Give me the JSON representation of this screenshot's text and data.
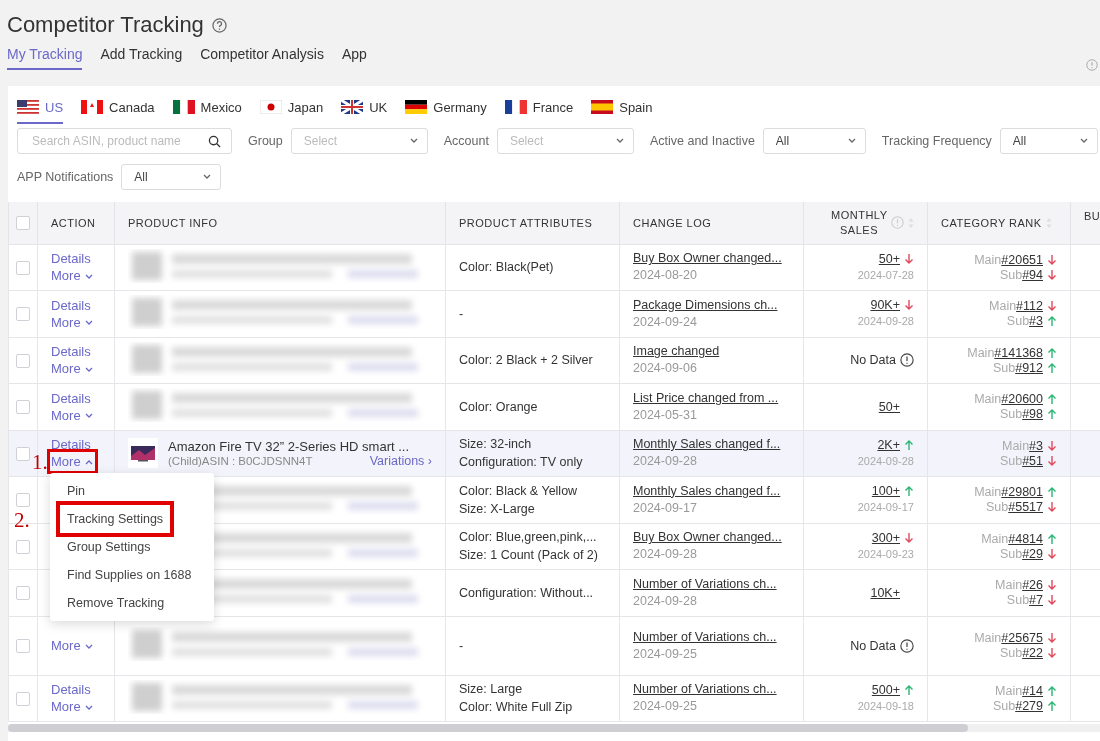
{
  "page": {
    "title": "Competitor Tracking"
  },
  "tabs": [
    {
      "label": "My Tracking",
      "selected": true
    },
    {
      "label": "Add Tracking",
      "selected": false
    },
    {
      "label": "Competitor Analysis",
      "selected": false
    },
    {
      "label": "App",
      "selected": false
    }
  ],
  "markets": [
    {
      "label": "US",
      "kind": "us",
      "selected": true
    },
    {
      "label": "Canada",
      "kind": "ca",
      "selected": false
    },
    {
      "label": "Mexico",
      "kind": "mx",
      "selected": false
    },
    {
      "label": "Japan",
      "kind": "jp",
      "selected": false
    },
    {
      "label": "UK",
      "kind": "uk",
      "selected": false
    },
    {
      "label": "Germany",
      "kind": "de",
      "selected": false
    },
    {
      "label": "France",
      "kind": "fr",
      "selected": false
    },
    {
      "label": "Spain",
      "kind": "es",
      "selected": false
    }
  ],
  "search": {
    "placeholder": "Search ASIN, product name"
  },
  "filters": [
    {
      "label": "Group",
      "placeholder": "Select"
    },
    {
      "label": "Account",
      "placeholder": "Select"
    },
    {
      "label": "Active and Inactive",
      "value": "All"
    },
    {
      "label": "Tracking Frequency",
      "value": "All"
    },
    {
      "label": "APP Notifications",
      "value": "All"
    }
  ],
  "table": {
    "select_all": {
      "checked": false
    },
    "columns": [
      "ACTION",
      "PRODUCT INFO",
      "PRODUCT ATTRIBUTES",
      "CHANGE LOG",
      "MONTHLY SALES",
      "CATEGORY RANK",
      "BU"
    ],
    "rows": [
      {
        "checked": false,
        "highlighted": false,
        "details": "Details",
        "more": "More",
        "expanded": false,
        "product": {
          "kind": "blurred"
        },
        "attributes": [
          "Color: Black(Pet)"
        ],
        "change": {
          "text": "Buy Box Owner changed...",
          "date": "2024-08-20"
        },
        "sales": {
          "kind": "value",
          "value": "50+",
          "rising": false,
          "date": "2024-07-28"
        },
        "rank": [
          {
            "label": "Main",
            "value": "#20651",
            "rising": false
          },
          {
            "label": "Sub",
            "value": "#94",
            "rising": false
          }
        ]
      },
      {
        "checked": false,
        "highlighted": false,
        "details": "Details",
        "more": "More",
        "expanded": false,
        "product": {
          "kind": "blurred"
        },
        "attributes": [
          "-"
        ],
        "change": {
          "text": "Package Dimensions ch...",
          "date": "2024-09-24"
        },
        "sales": {
          "kind": "value",
          "value": "90K+",
          "rising": false,
          "date": "2024-09-28"
        },
        "rank": [
          {
            "label": "Main",
            "value": "#112",
            "rising": false
          },
          {
            "label": "Sub",
            "value": "#3",
            "rising": true
          }
        ]
      },
      {
        "checked": false,
        "highlighted": false,
        "details": "Details",
        "more": "More",
        "expanded": false,
        "product": {
          "kind": "blurred"
        },
        "attributes": [
          "Color: 2 Black + 2 Silver"
        ],
        "change": {
          "text": "Image changed",
          "date": "2024-09-06"
        },
        "sales": {
          "kind": "no_data",
          "text": "No Data"
        },
        "rank": [
          {
            "label": "Main",
            "value": "#141368",
            "rising": true
          },
          {
            "label": "Sub",
            "value": "#912",
            "rising": true
          }
        ]
      },
      {
        "checked": false,
        "highlighted": false,
        "details": "Details",
        "more": "More",
        "expanded": false,
        "product": {
          "kind": "blurred"
        },
        "attributes": [
          "Color: Orange"
        ],
        "change": {
          "text": "List Price changed from ...",
          "date": "2024-05-31"
        },
        "sales": {
          "kind": "value",
          "value": "50+"
        },
        "rank": [
          {
            "label": "Main",
            "value": "#20600",
            "rising": true
          },
          {
            "label": "Sub",
            "value": "#98",
            "rising": true
          }
        ]
      },
      {
        "checked": false,
        "highlighted": true,
        "details": "Details",
        "more": "More",
        "expanded": true,
        "annotation": "1.",
        "product": {
          "kind": "product",
          "title": "Amazon Fire TV 32” 2-Series HD smart ...",
          "asin": "(Child)ASIN : B0CJDSNN4T",
          "variations": "Variations ›"
        },
        "attributes": [
          "Size: 32-inch",
          "Configuration: TV only"
        ],
        "change": {
          "text": "Monthly Sales changed f...",
          "date": "2024-09-28"
        },
        "sales": {
          "kind": "value",
          "value": "2K+",
          "rising": true,
          "date": "2024-09-28"
        },
        "rank": [
          {
            "label": "Main",
            "value": "#3",
            "rising": false
          },
          {
            "label": "Sub",
            "value": "#51",
            "rising": false
          }
        ]
      },
      {
        "checked": false,
        "highlighted": false,
        "product": {
          "kind": "blurred"
        },
        "attributes": [
          "Color: Black & Yellow",
          "Size: X-Large"
        ],
        "change": {
          "text": "Monthly Sales changed f...",
          "date": "2024-09-17"
        },
        "sales": {
          "kind": "value",
          "value": "100+",
          "rising": true,
          "date": "2024-09-17"
        },
        "rank": [
          {
            "label": "Main",
            "value": "#29801",
            "rising": true
          },
          {
            "label": "Sub",
            "value": "#5517",
            "rising": false
          }
        ]
      },
      {
        "checked": false,
        "highlighted": false,
        "product": {
          "kind": "blurred"
        },
        "attributes": [
          "Color: Blue,green,pink,...",
          "Size: 1 Count (Pack of 2)"
        ],
        "change": {
          "text": "Buy Box Owner changed...",
          "date": "2024-09-28"
        },
        "sales": {
          "kind": "value",
          "value": "300+",
          "rising": false,
          "date": "2024-09-23"
        },
        "rank": [
          {
            "label": "Main",
            "value": "#4814",
            "rising": true
          },
          {
            "label": "Sub",
            "value": "#29",
            "rising": false
          }
        ]
      },
      {
        "checked": false,
        "highlighted": false,
        "product": {
          "kind": "blurred"
        },
        "attributes": [
          "Configuration: Without..."
        ],
        "change": {
          "text": "Number of Variations ch...",
          "date": "2024-09-28"
        },
        "sales": {
          "kind": "value",
          "value": "10K+"
        },
        "rank": [
          {
            "label": "Main",
            "value": "#26",
            "rising": false
          },
          {
            "label": "Sub",
            "value": "#7",
            "rising": false
          }
        ]
      },
      {
        "checked": false,
        "highlighted": false,
        "more": "More",
        "expanded": false,
        "tall": true,
        "product": {
          "kind": "blurred"
        },
        "attributes": [
          "-"
        ],
        "change": {
          "text": "Number of Variations ch...",
          "date": "2024-09-25"
        },
        "sales": {
          "kind": "no_data",
          "text": "No Data"
        },
        "rank": [
          {
            "label": "Main",
            "value": "#25675",
            "rising": false
          },
          {
            "label": "Sub",
            "value": "#22",
            "rising": false
          }
        ]
      },
      {
        "checked": false,
        "highlighted": false,
        "details": "Details",
        "more": "More",
        "expanded": false,
        "product": {
          "kind": "blurred"
        },
        "attributes": [
          "Size: Large",
          "Color: White Full Zip"
        ],
        "change": {
          "text": "Number of Variations ch...",
          "date": "2024-09-25"
        },
        "sales": {
          "kind": "value",
          "value": "500+",
          "rising": true,
          "date": "2024-09-18"
        },
        "rank": [
          {
            "label": "Main",
            "value": "#14",
            "rising": true
          },
          {
            "label": "Sub",
            "value": "#279",
            "rising": true
          }
        ]
      }
    ]
  },
  "menu": {
    "items": [
      {
        "label": "Pin"
      },
      {
        "label": "Tracking Settings",
        "annotation": "2."
      },
      {
        "label": "Group Settings"
      },
      {
        "label": "Find Supplies on 1688"
      },
      {
        "label": "Remove Tracking"
      }
    ]
  }
}
